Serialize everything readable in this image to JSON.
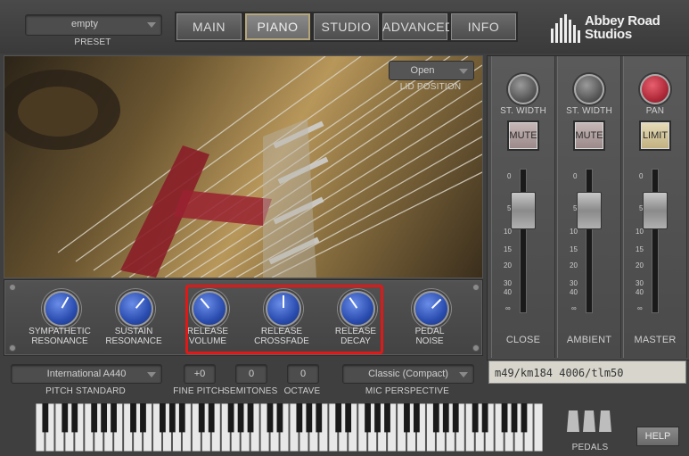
{
  "preset": {
    "value": "empty",
    "label": "PRESET"
  },
  "tabs": [
    {
      "label": "MAIN"
    },
    {
      "label": "PIANO",
      "active": true
    },
    {
      "label": "STUDIO"
    },
    {
      "label": "ADVANCED"
    },
    {
      "label": "INFO"
    }
  ],
  "logo": {
    "line1": "Abbey Road",
    "line2": "Studios"
  },
  "lid": {
    "value": "Open",
    "label": "LID POSITION"
  },
  "knobs": [
    {
      "line1": "SYMPATHETIC",
      "line2": "RESONANCE"
    },
    {
      "line1": "SUSTAIN",
      "line2": "RESONANCE"
    },
    {
      "line1": "RELEASE",
      "line2": "VOLUME"
    },
    {
      "line1": "RELEASE",
      "line2": "CROSSFADE"
    },
    {
      "line1": "RELEASE",
      "line2": "DECAY"
    },
    {
      "line1": "PEDAL",
      "line2": "NOISE"
    }
  ],
  "mixer": {
    "strips": [
      {
        "knob_label": "ST. WIDTH",
        "button": "MUTE",
        "name": "CLOSE"
      },
      {
        "knob_label": "ST. WIDTH",
        "button": "MUTE",
        "name": "AMBIENT"
      },
      {
        "knob_label": "PAN",
        "button": "LIMIT",
        "name": "MASTER"
      }
    ],
    "scale": [
      "0",
      "5",
      "10",
      "15",
      "20",
      "30",
      "40",
      "∞"
    ]
  },
  "mic_note": "m49/km184 4006/tlm50",
  "controls": {
    "pitch_standard": {
      "value": "International  A440",
      "label": "PITCH STANDARD"
    },
    "fine_pitch": {
      "value": "+0",
      "label": "FINE PITCH"
    },
    "semitones": {
      "value": "0",
      "label": "SEMITONES"
    },
    "octave": {
      "value": "0",
      "label": "OCTAVE"
    },
    "mic_perspective": {
      "value": "Classic (Compact)",
      "label": "MIC PERSPECTIVE"
    }
  },
  "pedals_label": "PEDALS",
  "help_label": "HELP",
  "colors": {
    "accent_red": "#e01818",
    "knob_blue": "#2a4db0"
  }
}
